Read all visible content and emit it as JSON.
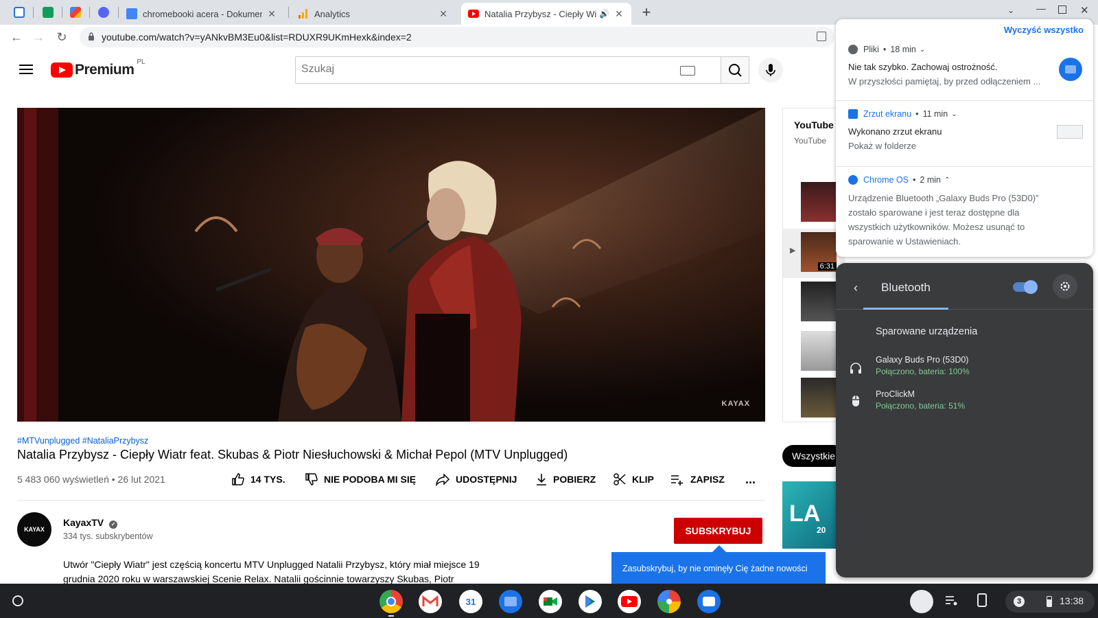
{
  "browser": {
    "pinned_tabs": [
      {
        "name": "pinned-tab-1",
        "color": "#1a73e8"
      },
      {
        "name": "pinned-tab-2",
        "color": "#0f9d58"
      },
      {
        "name": "pinned-tab-3",
        "color": "#f4b400"
      },
      {
        "name": "pinned-tab-discord",
        "color": "#5865f2"
      }
    ],
    "tabs": [
      {
        "title": "chromebooki acera - Dokumenty",
        "icon": "google-docs-icon",
        "color": "#4285f4"
      },
      {
        "title": "Analytics",
        "icon": "analytics-icon",
        "color": "#f9ab00"
      },
      {
        "title": "Natalia Przybysz - Ciepły Wiatr",
        "icon": "youtube-icon",
        "color": "#ff0000",
        "active": true
      }
    ],
    "url": "youtube.com/watch?v=yANkvBM3Eu0&list=RDUXR9UKmHexk&index=2"
  },
  "youtube": {
    "logo_text": "Premium",
    "country": "PL",
    "search_placeholder": "Szukaj",
    "video_watermark": "KAYAX",
    "hashtags": "#MTVunplugged #NataliaPrzybysz",
    "title": "Natalia Przybysz - Ciepły Wiatr feat. Skubas & Piotr Niesłuchowski & Michał Pepol (MTV Unplugged)",
    "meta": "5 483 060 wyświetleń • 26 lut 2021",
    "actions": {
      "like": "14 TYS.",
      "dislike": "NIE PODOBA MI SIĘ",
      "share": "UDOSTĘPNIJ",
      "download": "POBIERZ",
      "clip": "KLIP",
      "save": "ZAPISZ",
      "more": "..."
    },
    "channel": {
      "name": "KayaxTV",
      "avatar_text": "KAYAX",
      "subscribers": "334 tys. subskrybentów",
      "subscribe_label": "SUBSKRYBUJ"
    },
    "description": "Utwór  \"Ciepły Wiatr\" jest częścią koncertu MTV Unplugged Natalii Przybysz, który miał miejsce 19 grudnia 2020 roku w warszawskiej Scenie Relax. Natalii gościnnie towarzyszy Skubas, Piotr",
    "tooltip": "Zasubskrybuj, by nie ominęły Cię żadne nowości",
    "sidebar": {
      "mix_title": "YouTube",
      "mix_sub": "YouTube",
      "duration_badge": "6:31",
      "chip_label": "Wszystkie",
      "promo_text": "LA",
      "promo_sub": "20"
    }
  },
  "notifications": {
    "clear_all": "Wyczyść wszystko",
    "items": [
      {
        "app": "Pliki",
        "time": "18 min",
        "title": "Nie tak szybko. Zachowaj ostrożność.",
        "body": "W przyszłości pamiętaj, by przed odłączeniem ..."
      },
      {
        "app": "Zrzut ekranu",
        "time": "11 min",
        "title": "Wykonano zrzut ekranu",
        "body": "Pokaż w folderze"
      },
      {
        "app": "Chrome OS",
        "time": "2 min",
        "body": "Urządzenie Bluetooth „Galaxy Buds Pro (53D0)” zostało sparowane i jest teraz dostępne dla wszystkich użytkowników. Możesz usunąć to sparowanie w Ustawieniach."
      }
    ]
  },
  "bluetooth": {
    "title": "Bluetooth",
    "enabled": true,
    "section": "Sparowane urządzenia",
    "devices": [
      {
        "name": "Galaxy Buds Pro (53D0)",
        "status": "Połączono, bateria: 100%",
        "icon": "headphones-icon"
      },
      {
        "name": "ProClickM",
        "status": "Połączono, bateria: 51%",
        "icon": "mouse-icon"
      }
    ]
  },
  "shelf": {
    "apps": [
      {
        "name": "chrome-app",
        "color": "#ffffff"
      },
      {
        "name": "gmail-app",
        "color": "#ffffff"
      },
      {
        "name": "calendar-app",
        "color": "#ffffff",
        "label": "31"
      },
      {
        "name": "files-app",
        "color": "#1a73e8"
      },
      {
        "name": "meet-app",
        "color": "#ffffff"
      },
      {
        "name": "play-store-app",
        "color": "#ffffff"
      },
      {
        "name": "youtube-app",
        "color": "#ff0000"
      },
      {
        "name": "photos-app",
        "color": "#ffffff"
      },
      {
        "name": "messages-app",
        "color": "#1a73e8"
      }
    ],
    "notification_count": "3",
    "time": "13:38"
  }
}
